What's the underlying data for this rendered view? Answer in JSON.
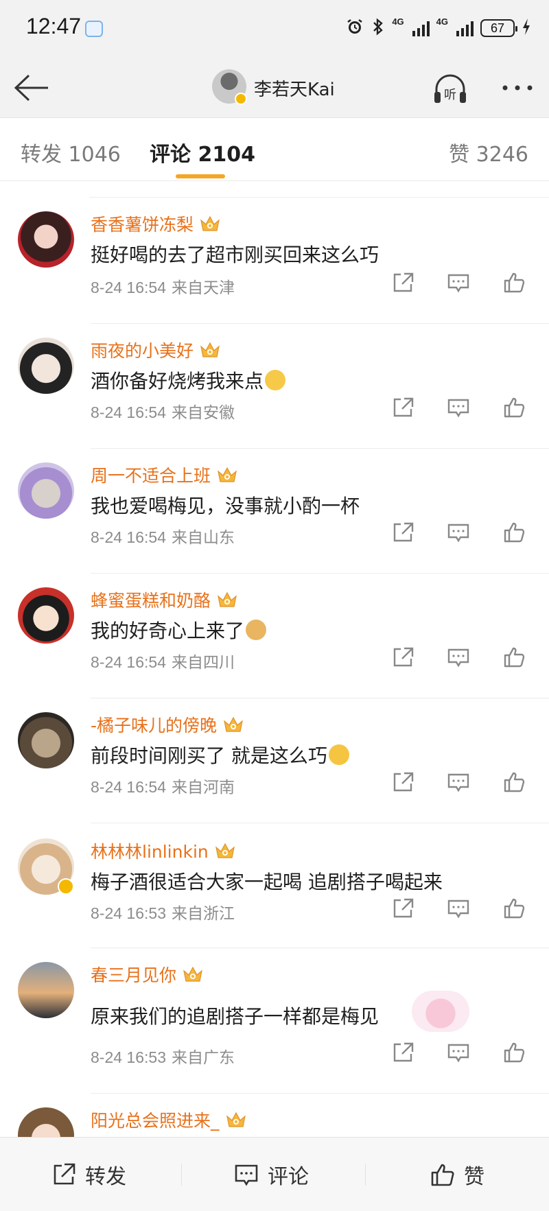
{
  "status_bar": {
    "time": "12:47",
    "network_1": "4G",
    "network_2": "4G",
    "battery": "67"
  },
  "header": {
    "title": "李若天Kai",
    "listen_label": "听"
  },
  "tabs": {
    "repost": "转发 1046",
    "comments": "评论 2104",
    "likes": "赞 3246",
    "active": "comments",
    "accent_color": "#f5a623"
  },
  "colors": {
    "username": "#e8711a",
    "meta": "#8c8c8c"
  },
  "comments": [
    {
      "username": "香香薯饼冻梨",
      "text": "挺好喝的去了超市刚买回来这么巧",
      "time": "8-24 16:54",
      "location": "来自天津",
      "emoji": ""
    },
    {
      "username": "雨夜的小美好",
      "text": "酒你备好烧烤我来点",
      "time": "8-24 16:54",
      "location": "来自安徽",
      "emoji": "face-emoji"
    },
    {
      "username": "周一不适合上班",
      "text": "我也爱喝梅见，没事就小酌一杯",
      "time": "8-24 16:54",
      "location": "来自山东",
      "emoji": ""
    },
    {
      "username": "蜂蜜蛋糕和奶酪",
      "text": "我的好奇心上来了",
      "time": "8-24 16:54",
      "location": "来自四川",
      "emoji": "doge-emoji"
    },
    {
      "username": "-橘子味儿的傍晚",
      "text": "前段时间刚买了 就是这么巧",
      "time": "8-24 16:54",
      "location": "来自河南",
      "emoji": "thinking-emoji"
    },
    {
      "username": "林林林linlinkin",
      "text": "梅子酒很适合大家一起喝 追剧搭子喝起来",
      "time": "8-24 16:53",
      "location": "来自浙江",
      "emoji": ""
    },
    {
      "username": "春三月见你",
      "text": "原来我们的追剧搭子一样都是梅见",
      "time": "8-24 16:53",
      "location": "来自广东",
      "emoji": ""
    },
    {
      "username": "阳光总会照进来_",
      "text": "",
      "time": "",
      "location": "",
      "emoji": ""
    }
  ],
  "bottom_bar": {
    "repost": "转发",
    "comment": "评论",
    "like": "赞"
  }
}
